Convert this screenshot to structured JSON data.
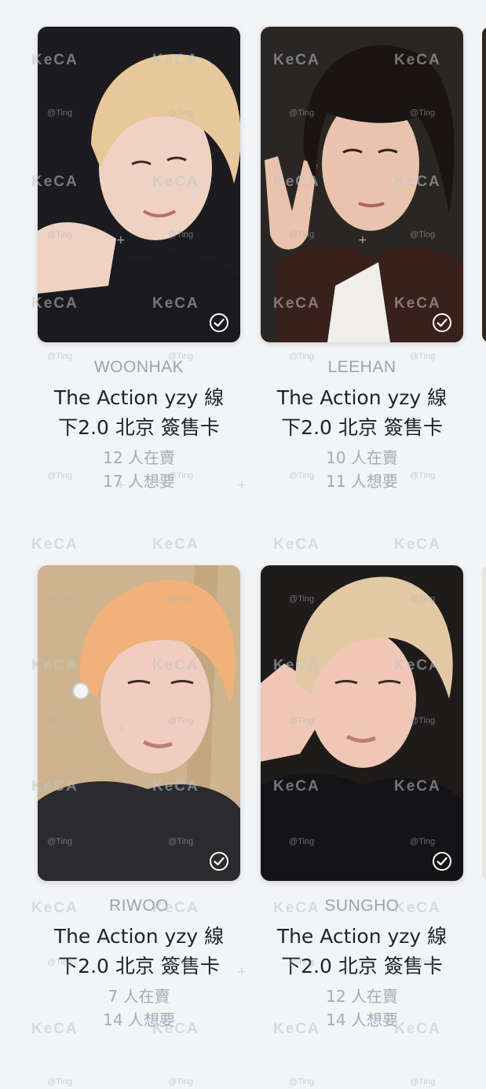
{
  "watermark": {
    "brand": "KeCA",
    "handle": "@Ting"
  },
  "cards": [
    {
      "member": "WOONHAK",
      "title": "The Action yzy 線\n下2.0 北京 簽售卡",
      "selling": "12 人在賣",
      "wanting": "17 人想要",
      "photo": {
        "bg": "#1c1c20",
        "hair": "#e8c89a",
        "skin": "#efd3c2",
        "shirt": "#1a1a1e"
      }
    },
    {
      "member": "LEEHAN",
      "title": "The Action yzy 線\n下2.0 北京 簽售卡",
      "selling": "10 人在賣",
      "wanting": "11 人想要",
      "photo": {
        "bg": "#2a2624",
        "hair": "#1a1412",
        "skin": "#e9c3ac",
        "shirt": "#3a201a"
      }
    },
    {
      "member": "RIWOO",
      "title": "The Action yzy 線\n下2.0 北京 簽售卡",
      "selling": "7 人在賣",
      "wanting": "14 人想要",
      "photo": {
        "bg": "#cdb48f",
        "hair": "#f0b27a",
        "skin": "#f0cdbf",
        "shirt": "#2b2b2e"
      }
    },
    {
      "member": "SUNGHO",
      "title": "The Action yzy 線\n下2.0 北京 簽售卡",
      "selling": "12 人在賣",
      "wanting": "14 人想要",
      "photo": {
        "bg": "#1e1b1a",
        "hair": "#e2c9a4",
        "skin": "#f0c7b6",
        "shirt": "#141416"
      }
    }
  ]
}
